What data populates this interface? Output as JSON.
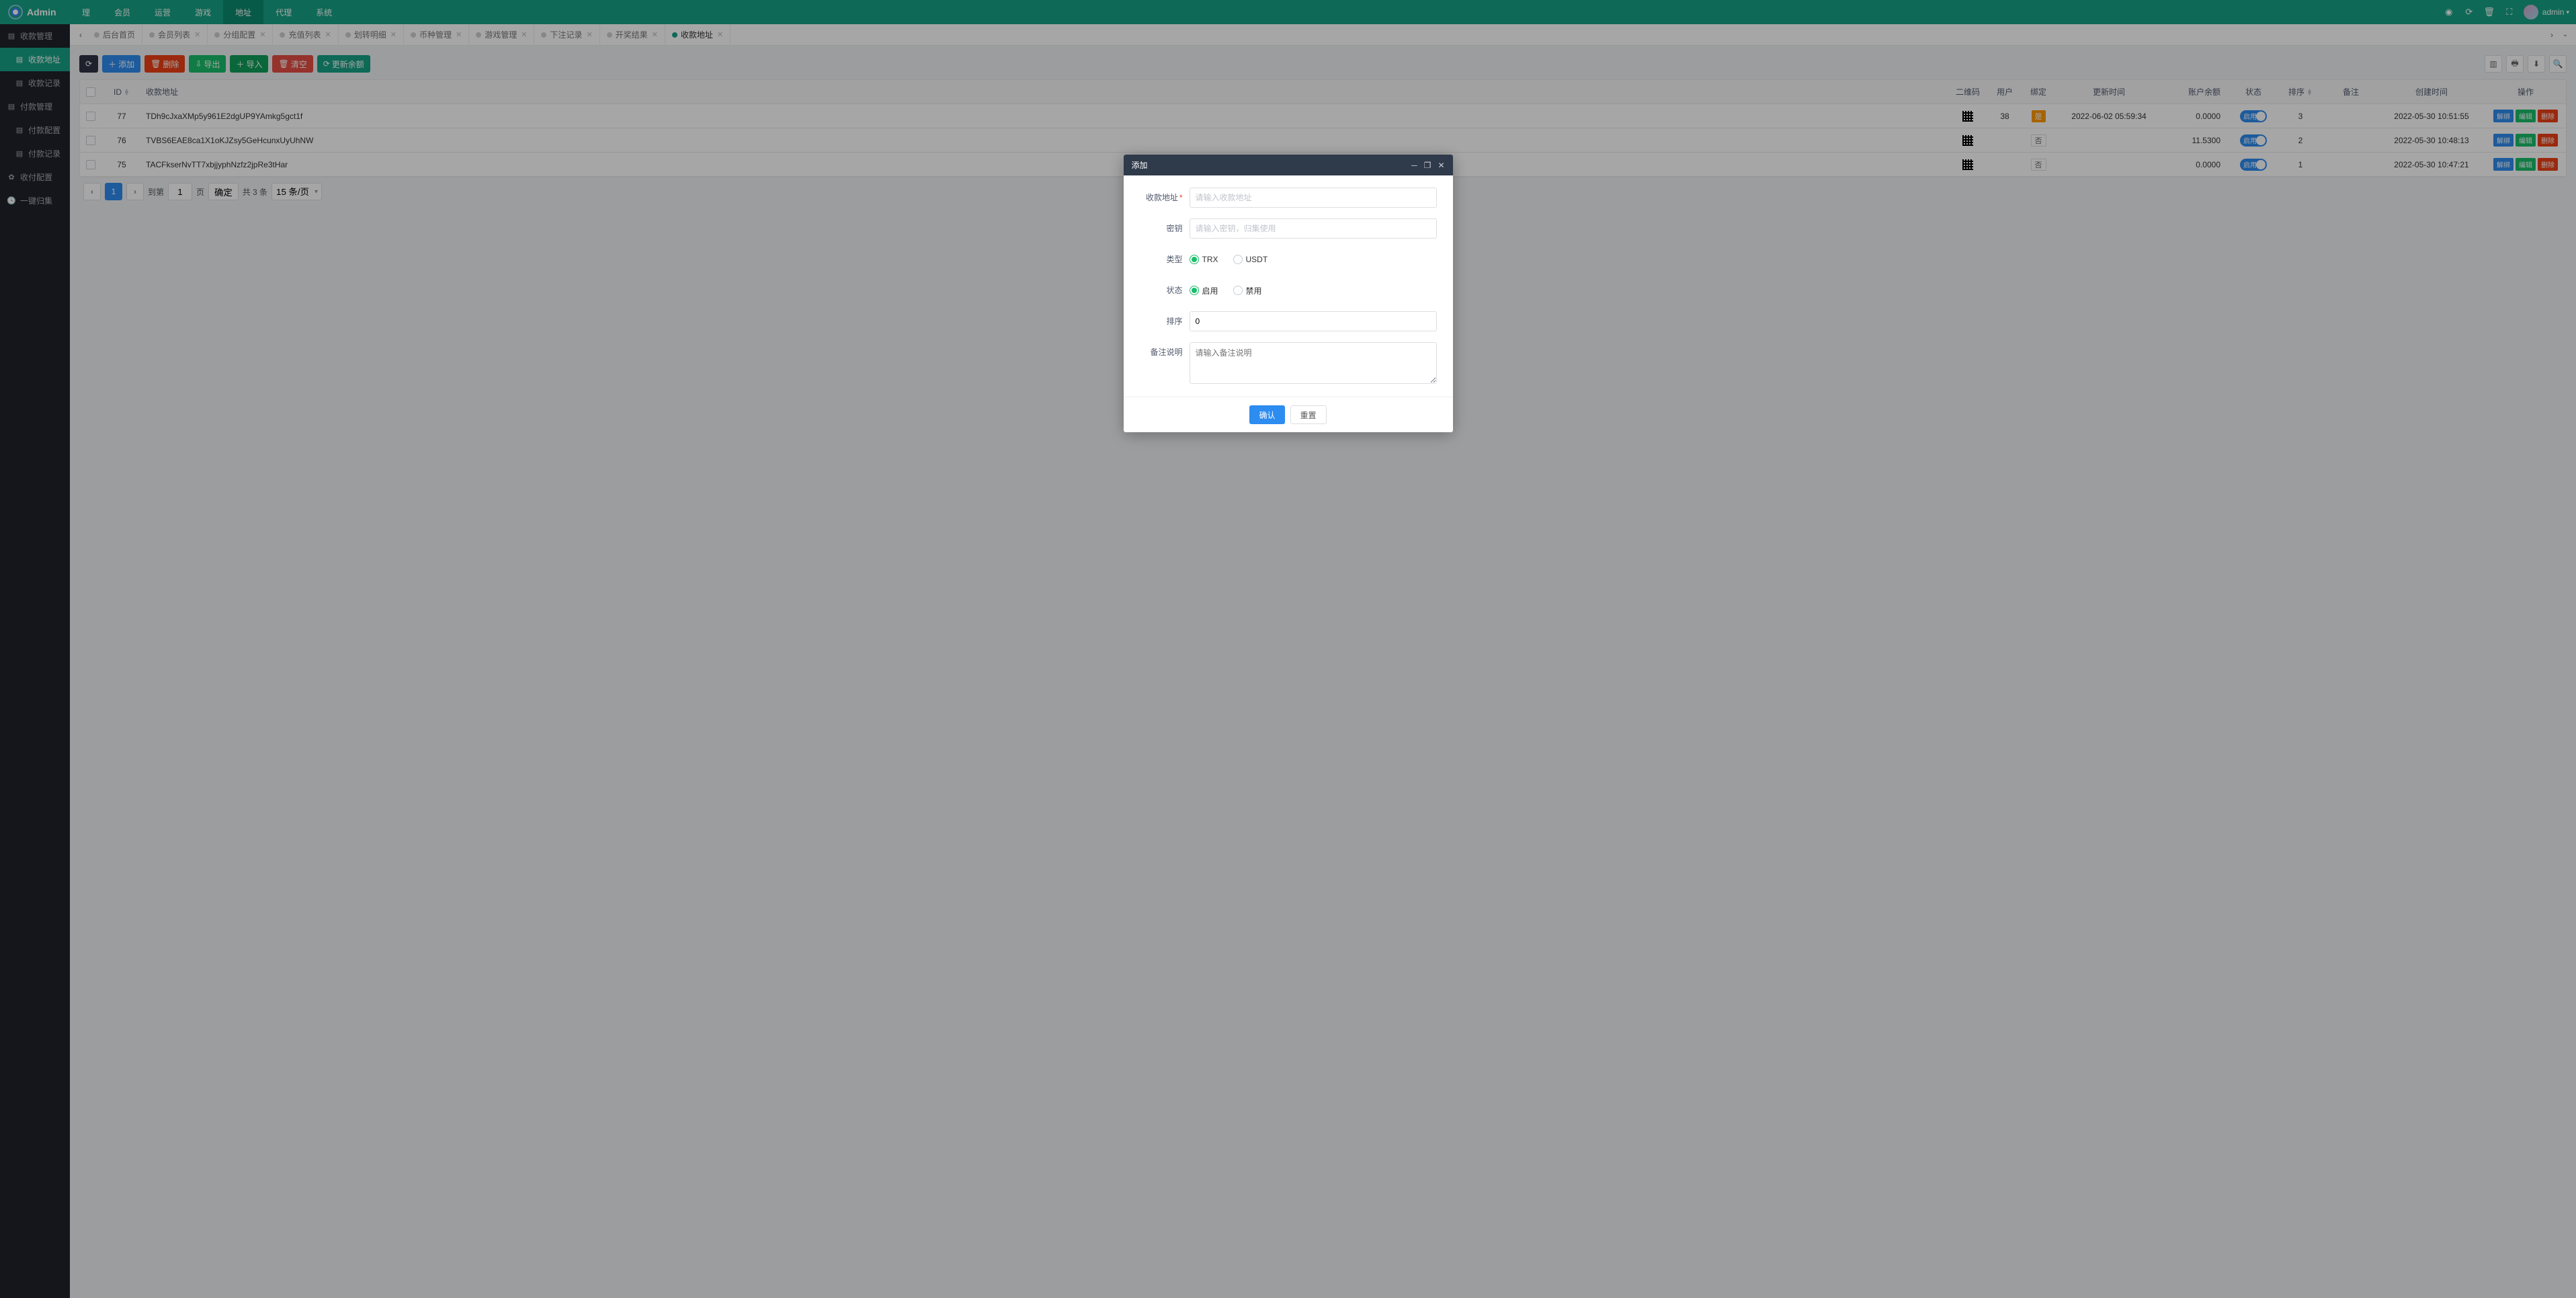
{
  "brand": "Admin",
  "topnav": {
    "items": [
      "理",
      "会员",
      "运营",
      "游戏",
      "地址",
      "代理",
      "系统"
    ],
    "activeIndex": 4
  },
  "sidebar": [
    {
      "icon": "▤",
      "label": "收款管理",
      "type": "h"
    },
    {
      "icon": "▤",
      "label": "收款地址",
      "type": "sub",
      "active": true
    },
    {
      "icon": "▤",
      "label": "收款记录",
      "type": "sub"
    },
    {
      "icon": "▤",
      "label": "付款管理",
      "type": "h"
    },
    {
      "icon": "▤",
      "label": "付款配置",
      "type": "sub"
    },
    {
      "icon": "▤",
      "label": "付款记录",
      "type": "sub"
    },
    {
      "icon": "✿",
      "label": "收付配置",
      "type": "h"
    },
    {
      "icon": "🕓",
      "label": "一键归集",
      "type": "h"
    }
  ],
  "tabs": {
    "items": [
      "后台首页",
      "会员列表",
      "分组配置",
      "充值列表",
      "划转明细",
      "币种管理",
      "游戏管理",
      "下注记录",
      "开奖结果",
      "收款地址"
    ],
    "activeIndex": 9
  },
  "toolbar": {
    "refresh": "↻",
    "add": "添加",
    "delete": "删除",
    "export": "导出",
    "import": "导入",
    "clear": "清空",
    "balance": "更新余额"
  },
  "columns": {
    "id": "ID",
    "addr": "收款地址",
    "qr": "二维码",
    "user": "用户",
    "bind": "绑定",
    "upd": "更新时间",
    "bal": "账户余额",
    "stat": "状态",
    "sort": "排序",
    "remark": "备注",
    "create": "创建时间",
    "act": "操作"
  },
  "rows": [
    {
      "id": "77",
      "addr": "TDh9cJxaXMp5y961E2dgUP9YAmkg5gct1f",
      "user": "38",
      "bind": "是",
      "bindY": true,
      "upd": "2022-06-02 05:59:34",
      "bal": "0.0000",
      "stat": "启用",
      "sort": "3",
      "create": "2022-05-30 10:51:55"
    },
    {
      "id": "76",
      "addr": "TVBS6EAE8ca1X1oKJZsy5GeHcunxUyUhNW",
      "user": "",
      "bind": "否",
      "bindY": false,
      "upd": "",
      "bal": "11.5300",
      "stat": "启用",
      "sort": "2",
      "create": "2022-05-30 10:48:13"
    },
    {
      "id": "75",
      "addr": "TACFkserNvTT7xbjjyphNzfz2jpRe3tHar",
      "user": "",
      "bind": "否",
      "bindY": false,
      "upd": "",
      "bal": "0.0000",
      "stat": "启用",
      "sort": "1",
      "create": "2022-05-30 10:47:21"
    }
  ],
  "rowActions": {
    "unbind": "解绑",
    "edit": "编辑",
    "del": "删除"
  },
  "pager": {
    "page": "1",
    "to": "到第",
    "pageUnit": "页",
    "confirm": "确定",
    "total": "共 3 条",
    "per": "15 条/页"
  },
  "modal": {
    "title": "添加",
    "labels": {
      "addr": "收款地址",
      "key": "密钥",
      "type": "类型",
      "status": "状态",
      "sort": "排序",
      "remark": "备注说明"
    },
    "ph": {
      "addr": "请输入收款地址",
      "key": "请输入密钥，归集使用",
      "remark": "请输入备注说明"
    },
    "typeOpts": [
      "TRX",
      "USDT"
    ],
    "statusOpts": [
      "启用",
      "禁用"
    ],
    "sortVal": "0",
    "ok": "确认",
    "reset": "重置"
  },
  "user": {
    "name": "admin"
  }
}
